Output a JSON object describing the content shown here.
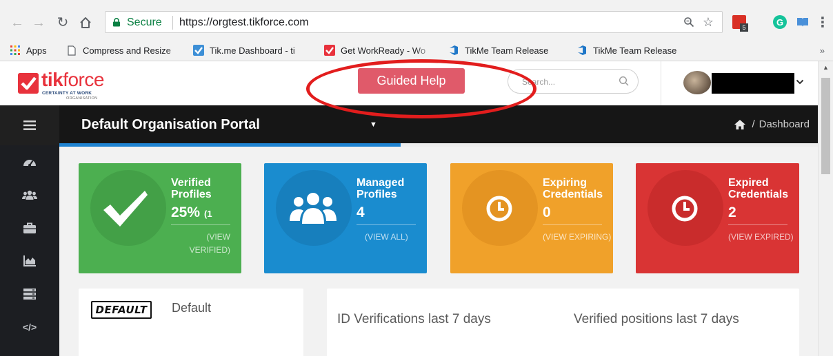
{
  "browser": {
    "secure_label": "Secure",
    "url": "https://orgtest.tikforce.com",
    "extension_badge": "5",
    "bookmarks": [
      {
        "label": "Apps",
        "icon": "apps-grid-icon"
      },
      {
        "label": "Compress and Resize",
        "icon": "page-icon"
      },
      {
        "label": "Tik.me Dashboard - ti",
        "icon": "tikme-icon"
      },
      {
        "label": "Get WorkReady - Wo",
        "icon": "tikme-icon"
      },
      {
        "label": "TikMe Team Release",
        "icon": "azure-devops-icon"
      },
      {
        "label": "TikMe Team Release",
        "icon": "azure-devops-icon"
      }
    ],
    "bookmarks_more": "»"
  },
  "header": {
    "logo_brand_bold": "tik",
    "logo_brand_light": "force",
    "logo_tagline": "CERTAINTY AT WORK",
    "logo_sub": "ORGANISATION",
    "guided_help_label": "Guided Help",
    "search_placeholder": "Search..."
  },
  "titlebar": {
    "portal_title": "Default Organisation Portal",
    "breadcrumb": "Dashboard",
    "progress_percent": 45
  },
  "cards": [
    {
      "title_l1": "Verified",
      "title_l2": "Profiles",
      "value": "25%",
      "value_extra": "(1",
      "link": "(VIEW VERIFIED)",
      "color": "#4caf50",
      "circle": "#43a047",
      "icon": "checkmark-icon"
    },
    {
      "title_l1": "Managed",
      "title_l2": "Profiles",
      "value": "4",
      "value_extra": "",
      "link": "(VIEW ALL)",
      "color": "#1a8ccf",
      "circle": "#177fbd",
      "icon": "users-icon"
    },
    {
      "title_l1": "Expiring",
      "title_l2": "Credentials",
      "value": "0",
      "value_extra": "",
      "link": "(VIEW EXPIRING)",
      "color": "#f0a12a",
      "circle": "#e49422",
      "icon": "clock-icon"
    },
    {
      "title_l1": "Expired",
      "title_l2": "Credentials",
      "value": "2",
      "value_extra": "",
      "link": "(VIEW EXPIRED)",
      "color": "#d93434",
      "circle": "#c92c2c",
      "icon": "clock-icon"
    }
  ],
  "org_panel": {
    "logo_text": "DEFAULT",
    "name": "Default"
  },
  "charts_panel": {
    "id_verifications_title": "ID Verifications last 7 days",
    "verified_positions_title": "Verified positions last 7 days"
  },
  "colors": {
    "accent_red": "#e8323c",
    "guided_help": "#e05a6a",
    "annotation": "#e21d1d",
    "titlebar": "#161616",
    "sidebar": "#1c1e22"
  }
}
